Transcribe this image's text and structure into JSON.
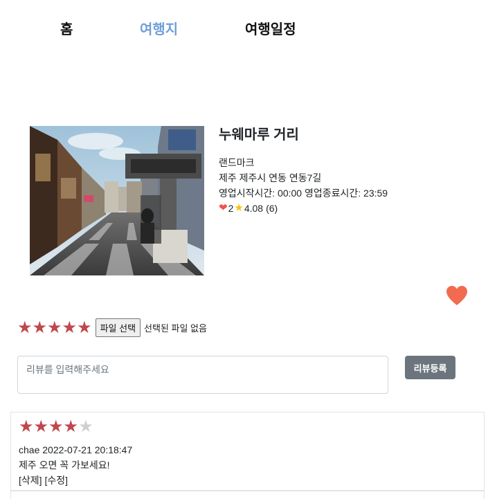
{
  "nav": {
    "home": "홈",
    "destinations": "여행지",
    "itinerary": "여행일정"
  },
  "place": {
    "title": "누웨마루 거리",
    "category": "랜드마크",
    "address": "제주 제주시 연동 연동7길",
    "hours": "영업시작시간: 00:00 영업종료시간: 23:59",
    "likes": "2",
    "rating": "4.08",
    "review_count": "(6)"
  },
  "review_form": {
    "rating": 5,
    "file_button": "파일 선택",
    "file_status": "선택된 파일 없음",
    "placeholder": "리뷰를 입력해주세요",
    "value": "",
    "submit_label": "리뷰등록"
  },
  "reviews": [
    {
      "stars": 4,
      "max_stars": 5,
      "author": "chae",
      "datetime": "2022-07-21 20:18:47",
      "content": "제주 오면 꼭 가보세요!",
      "delete_label": "[삭제]",
      "edit_label": "[수정]"
    }
  ],
  "colors": {
    "active_nav": "#6f9fd8",
    "star_filled": "#c0474c",
    "star_empty": "#cfcfcf",
    "heart": "#f26b50",
    "submit_bg": "#6c757d"
  },
  "icons": {
    "heart": "heart-icon",
    "star": "star-icon"
  }
}
